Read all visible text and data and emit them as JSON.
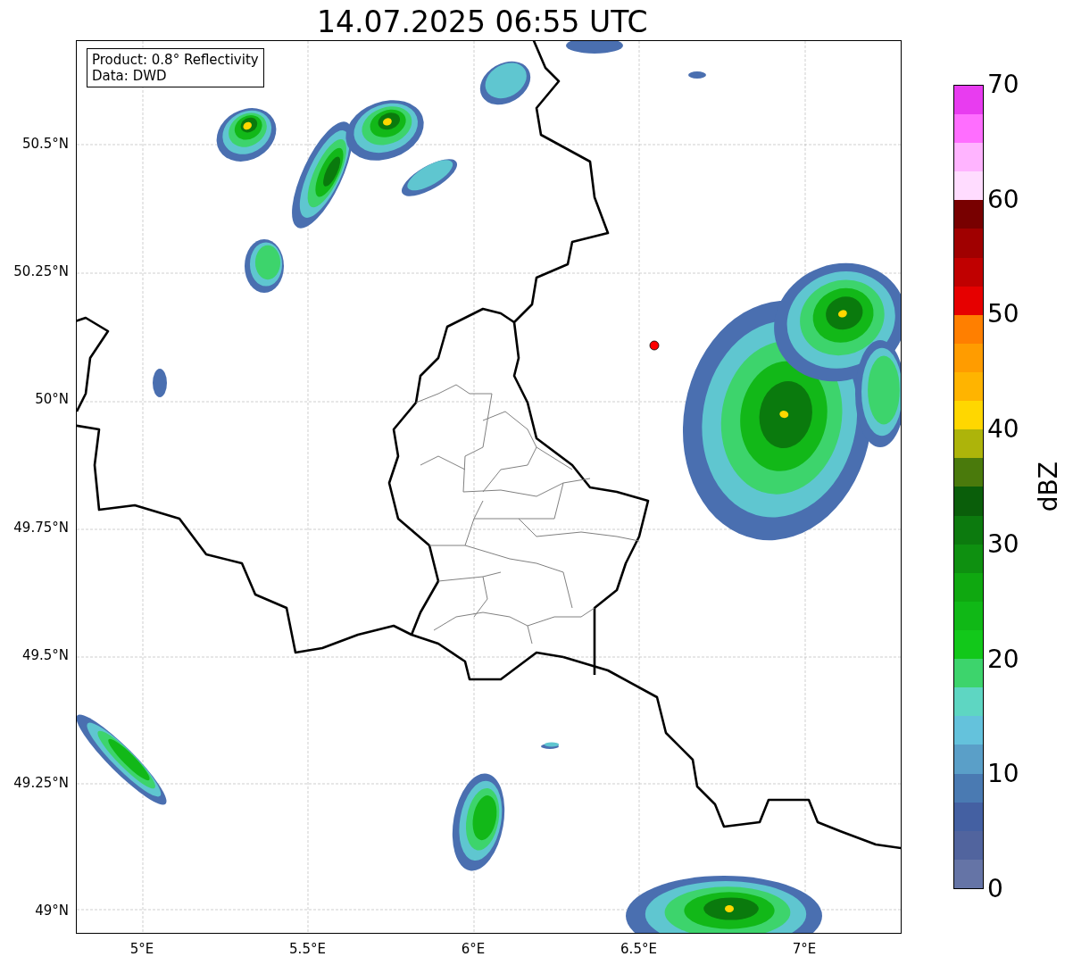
{
  "title": "14.07.2025 06:55 UTC",
  "info_box": {
    "lines": [
      "Product: 0.8° Reflectivity",
      "Data: DWD"
    ]
  },
  "map": {
    "lat_labels": [
      "50.5°N",
      "50.25°N",
      "50°N",
      "49.75°N",
      "49.5°N",
      "49.25°N",
      "49°N"
    ],
    "lon_labels": [
      "5°E",
      "5.5°E",
      "6°E",
      "6.5°E",
      "7°E"
    ]
  },
  "colorbar": {
    "label": "dBZ",
    "ticks": [
      "70",
      "60",
      "50",
      "40",
      "30",
      "20",
      "10",
      "0"
    ],
    "bins": [
      {
        "color": "#6574a6"
      },
      {
        "color": "#51649e"
      },
      {
        "color": "#4460a2"
      },
      {
        "color": "#4a7ab2"
      },
      {
        "color": "#5a9fc8"
      },
      {
        "color": "#64c2dc"
      },
      {
        "color": "#5ed6c2"
      },
      {
        "color": "#3dd46c"
      },
      {
        "color": "#12c81a"
      },
      {
        "color": "#10b816"
      },
      {
        "color": "#0fa810"
      },
      {
        "color": "#0e9010"
      },
      {
        "color": "#0c7a0e"
      },
      {
        "color": "#0a5e0a"
      },
      {
        "color": "#4a7a0c"
      },
      {
        "color": "#adb40a"
      },
      {
        "color": "#ffd700"
      },
      {
        "color": "#ffb400"
      },
      {
        "color": "#ff9c00"
      },
      {
        "color": "#ff7f00"
      },
      {
        "color": "#e60000"
      },
      {
        "color": "#c00000"
      },
      {
        "color": "#a00000"
      },
      {
        "color": "#780000"
      },
      {
        "color": "#ffdcff"
      },
      {
        "color": "#ffb4ff"
      },
      {
        "color": "#ff6eff"
      },
      {
        "color": "#e83cf0"
      }
    ]
  }
}
